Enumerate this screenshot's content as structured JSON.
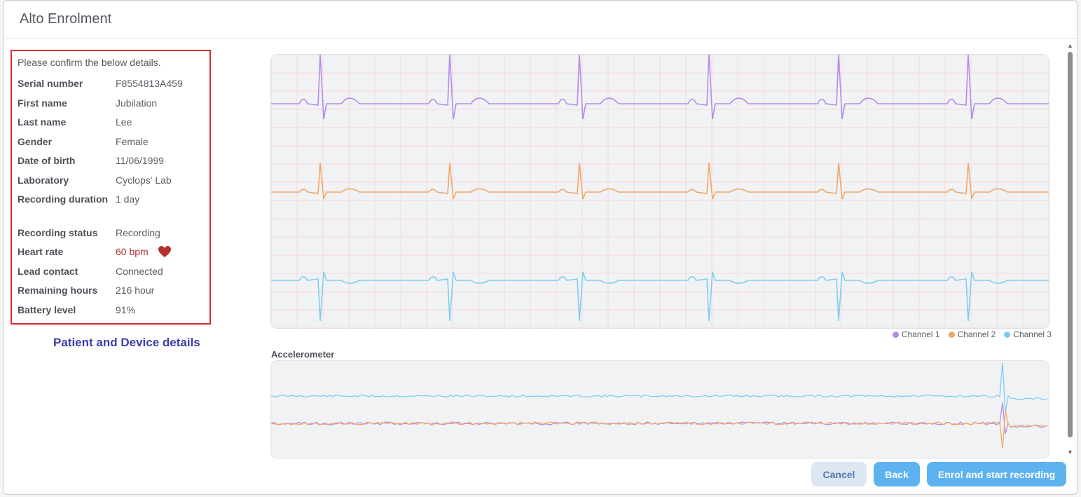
{
  "modal": {
    "title": "Alto Enrolment"
  },
  "details": {
    "intro": "Please confirm the below details.",
    "rows": [
      {
        "label": "Serial number",
        "value": "F8554813A459"
      },
      {
        "label": "First name",
        "value": "Jubilation"
      },
      {
        "label": "Last name",
        "value": "Lee"
      },
      {
        "label": "Gender",
        "value": "Female"
      },
      {
        "label": "Date of birth",
        "value": "11/06/1999"
      },
      {
        "label": "Laboratory",
        "value": "Cyclops' Lab"
      },
      {
        "label": "Recording duration",
        "value": "1 day"
      },
      {
        "label": "Recording status",
        "value": "Recording"
      },
      {
        "label": "Heart rate",
        "value": "60 bpm"
      },
      {
        "label": "Lead contact",
        "value": "Connected"
      },
      {
        "label": "Remaining hours",
        "value": "216 hour"
      },
      {
        "label": "Battery level",
        "value": "91%"
      }
    ],
    "heart_icon": "heart-icon",
    "heart_color": "#b5302c",
    "caption": "Patient and Device details"
  },
  "ecg": {
    "legend": [
      {
        "name": "Channel 1",
        "color": "#b48ce8"
      },
      {
        "name": "Channel 2",
        "color": "#f0a868"
      },
      {
        "name": "Channel 3",
        "color": "#7fcdf0"
      }
    ],
    "grid_color": "#f7d6dc"
  },
  "accelerometer": {
    "title": "Accelerometer"
  },
  "footer": {
    "cancel_label": "Cancel",
    "back_label": "Back",
    "enrol_label": "Enrol and start recording"
  }
}
